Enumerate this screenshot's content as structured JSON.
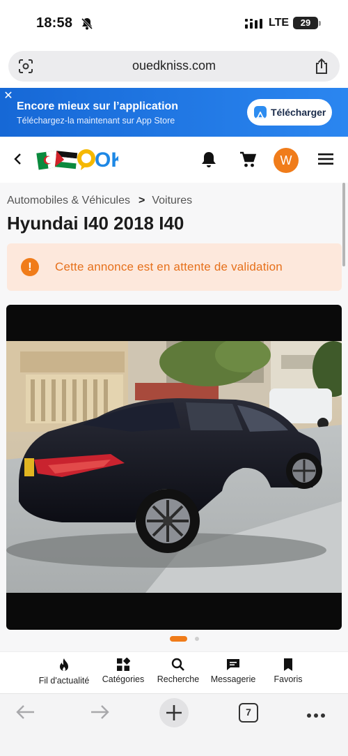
{
  "status_bar": {
    "time": "18:58",
    "network": "LTE",
    "battery": "29"
  },
  "browser": {
    "url": "ouedkniss.com",
    "tabs_count": "7"
  },
  "app_banner": {
    "title": "Encore mieux sur l’application",
    "subtitle": "Téléchargez-la maintenant sur App Store",
    "button_label": "Télécharger"
  },
  "header": {
    "avatar_letter": "W",
    "logo_text": "OK"
  },
  "breadcrumb": {
    "items": [
      "Automobiles & Véhicules",
      "Voitures"
    ]
  },
  "listing": {
    "title": "Hyundai I40 2018 I40",
    "status_message": "Cette annonce est en attente de validation"
  },
  "gallery": {
    "current_index": 1,
    "total": 2
  },
  "bottom_nav": {
    "items": [
      {
        "label": "Fil d'actualité",
        "icon": "fire-icon"
      },
      {
        "label": "Catégories",
        "icon": "categories-icon"
      },
      {
        "label": "Recherche",
        "icon": "search-icon"
      },
      {
        "label": "Messagerie",
        "icon": "chat-icon"
      },
      {
        "label": "Favoris",
        "icon": "bookmark-icon"
      }
    ]
  },
  "colors": {
    "brand_orange": "#f07c1a",
    "banner_blue": "#1a73e8",
    "alert_bg": "#fde8dc"
  }
}
